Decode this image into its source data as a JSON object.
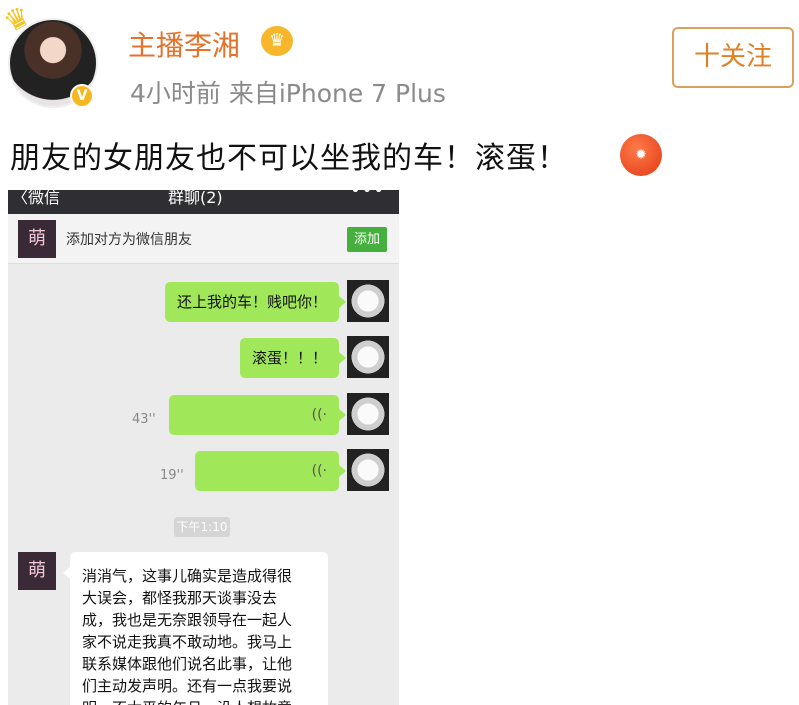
{
  "header": {
    "username": "主播李湘",
    "crown_icon": "crown-icon",
    "vip_icon": "crown-badge-icon",
    "verified_badge": "V",
    "meta": "4小时前  来自iPhone 7 Plus",
    "follow_label": "十关注"
  },
  "post": {
    "text": "朋友的女朋友也不可以坐我的车！滚蛋！",
    "emoji_icon": "angry-face-icon"
  },
  "wechat": {
    "back_label": "〈微信",
    "title": "群聊(2)",
    "more_icon": "more-dots-icon",
    "friend_avatar_char": "萌",
    "add_friend_text": "添加对方为微信朋友",
    "add_button": "添加",
    "messages": [
      {
        "text": "还上我的车！贱吧你！"
      },
      {
        "text": "滚蛋！！！"
      }
    ],
    "voice": [
      {
        "duration": "43''"
      },
      {
        "duration": "19''"
      }
    ],
    "timestamp": "下午1:10",
    "reply_lines": [
      "消消气，这事儿确实是造成得很",
      "大误会，都怪我那天谈事没去",
      "成，我也是无奈跟领导在一起人",
      "家不说走我真不敢动地。我马上",
      "联系媒体跟他们说名此事，让他",
      "们主动发声明。还有一点我要说",
      "明，不太平的年月，没人想故意"
    ]
  }
}
